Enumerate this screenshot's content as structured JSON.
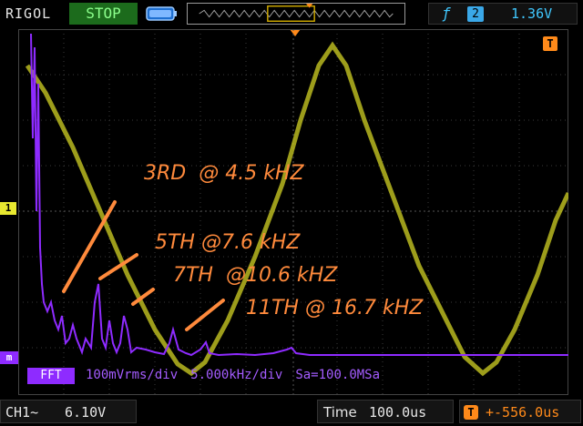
{
  "top_bar": {
    "brand": "RIGOL",
    "run_state": "STOP",
    "trigger_source": "2",
    "trigger_level": "1.36V"
  },
  "markers": {
    "channel": "1",
    "math": "m",
    "trigger": "T"
  },
  "fft": {
    "tag": "FFT",
    "scale": "100mVrms/div",
    "frequency_scale": "5.000kHz/div",
    "sample_rate": "Sa=100.0MSa"
  },
  "annotations": [
    {
      "label": "3RD",
      "freq": "@ 4.5 kHZ"
    },
    {
      "label": "5TH",
      "freq": "@7.6 kHZ"
    },
    {
      "label": "7TH",
      "freq": "@10.6 kHZ"
    },
    {
      "label": "11TH",
      "freq": "@ 16.7 kHZ"
    }
  ],
  "bottom_bar": {
    "channel_label": "CH1~",
    "channel_scale": "6.10V",
    "timebase_label": "Time",
    "timebase_value": "100.0us",
    "trigger_offset": "+-556.0us"
  },
  "colors": {
    "ch1": "#b8b820",
    "fft": "#8e2bff",
    "annotation": "#ff8a3c",
    "trigger": "#ff8a1a"
  }
}
